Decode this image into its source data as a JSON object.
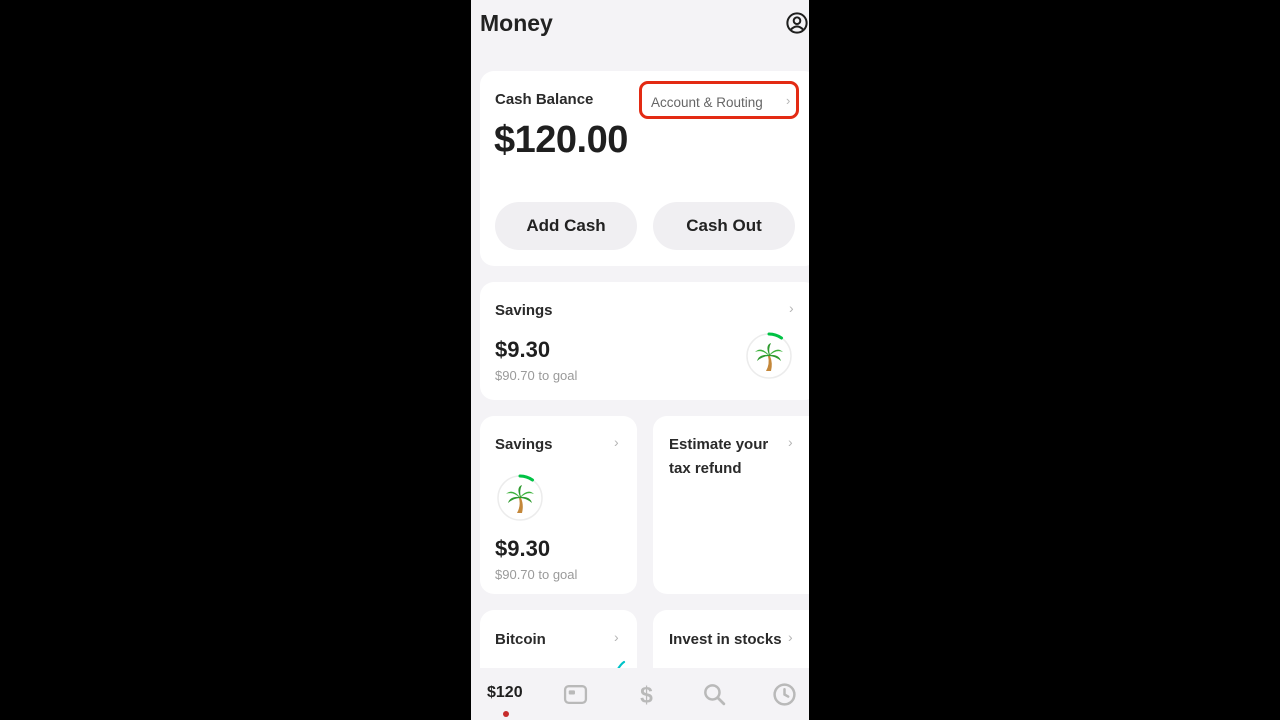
{
  "header": {
    "title": "Money",
    "profile_icon": "profile-icon"
  },
  "cash_balance": {
    "label": "Cash Balance",
    "amount": "$120.00",
    "account_link": "Account & Routing",
    "add_cash": "Add Cash",
    "cash_out": "Cash Out",
    "highlight_color": "#e32a13"
  },
  "savings_wide": {
    "label": "Savings",
    "amount": "$9.30",
    "goal": "$90.70 to goal",
    "icon": "palm-tree-icon",
    "progress": 0.093
  },
  "savings_small": {
    "label": "Savings",
    "amount": "$9.30",
    "goal": "$90.70 to goal",
    "icon": "palm-tree-icon",
    "progress": 0.093
  },
  "tax": {
    "label_line1": "Estimate your",
    "label_line2": "tax refund"
  },
  "bitcoin": {
    "label": "Bitcoin"
  },
  "stocks": {
    "label": "Invest in stocks"
  },
  "chevron": "›",
  "tabbar": {
    "balance": "$120",
    "items": [
      "card-icon",
      "dollar-icon",
      "search-icon",
      "clock-icon"
    ]
  }
}
